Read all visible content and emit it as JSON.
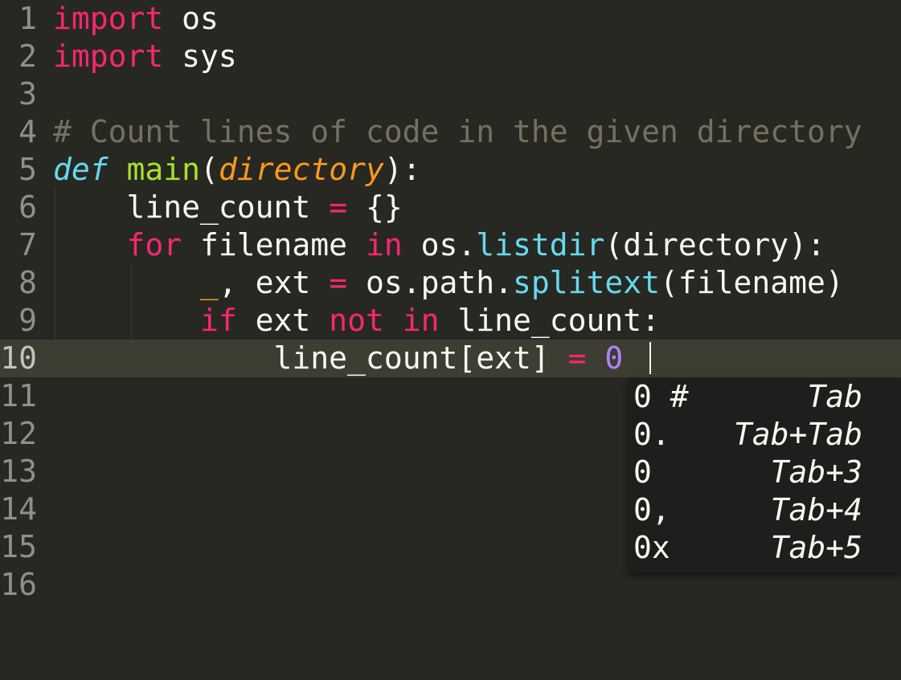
{
  "editor": {
    "line_numbers": [
      "1",
      "2",
      "3",
      "4",
      "5",
      "6",
      "7",
      "8",
      "9",
      "10",
      "11",
      "12",
      "13",
      "14",
      "15",
      "16"
    ],
    "line1": {
      "kw": "import",
      "rest": " os"
    },
    "line2": {
      "kw": "import",
      "rest": " sys"
    },
    "line4": {
      "comment": "# Count lines of code in the given directory"
    },
    "line5": {
      "def": "def",
      "sp": " ",
      "fn": "main",
      "p1": "(",
      "param": "directory",
      "p2": "):"
    },
    "line6": {
      "indent": "    ",
      "a": "line_count ",
      "op": "=",
      "b": " {}"
    },
    "line7": {
      "indent": "    ",
      "kw1": "for",
      "a": " filename ",
      "kw2": "in",
      "b": " os.",
      "builtin": "listdir",
      "c": "(directory):"
    },
    "line8": {
      "indent": "        ",
      "under": "_",
      "a": ", ext ",
      "op": "=",
      "b": " os.path.",
      "builtin": "splitext",
      "c": "(filename)"
    },
    "line9": {
      "indent": "        ",
      "kw1": "if",
      "a": " ext ",
      "kw2": "not",
      "sp": " ",
      "kw3": "in",
      "b": " line_count:"
    },
    "line10": {
      "indent": "            ",
      "a": "line_count[ext] ",
      "op": "=",
      "sp": " ",
      "num": "0"
    }
  },
  "autocomplete": {
    "items": [
      {
        "label": "0 #",
        "hint": "Tab"
      },
      {
        "label": "0.",
        "hint": "Tab+Tab"
      },
      {
        "label": "0",
        "hint": "Tab+3"
      },
      {
        "label": "0,",
        "hint": "Tab+4"
      },
      {
        "label": "0x",
        "hint": "Tab+5"
      }
    ]
  },
  "colors": {
    "background": "#272822",
    "keyword": "#f92672",
    "function": "#a6e22e",
    "storage": "#66d9ef",
    "parameter": "#fd971f",
    "number": "#ae81ff",
    "comment": "#75715e"
  }
}
